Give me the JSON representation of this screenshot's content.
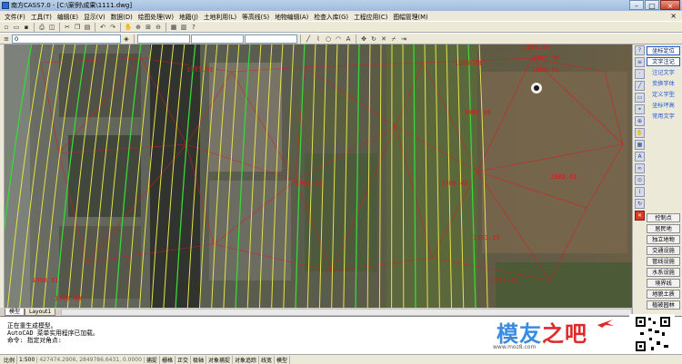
{
  "window": {
    "title": "南方CASS7.0 - [C:\\案例\\成果\\1111.dwg]",
    "buttons": [
      "–",
      "□",
      "×"
    ]
  },
  "menu": [
    "文件(F)",
    "工具(T)",
    "编辑(E)",
    "显示(V)",
    "数据(D)",
    "绘图处理(W)",
    "地籍(J)",
    "土地利用(L)",
    "等高线(S)",
    "地物编辑(A)",
    "检查入库(G)",
    "工程应用(C)",
    "图幅管理(M)"
  ],
  "menu_close": "×",
  "toolbar": {
    "layer_combo": "0"
  },
  "canvas": {
    "labels": [
      "1989.54",
      "1987.99",
      "1985.62",
      "1991.61",
      "1990.58",
      "1988.99",
      "1991.02",
      "1986.48",
      "1989.61",
      "1991.19",
      "1992.81",
      "1990.81",
      "1989.88"
    ]
  },
  "layout_tabs": [
    "模型",
    "Layout1"
  ],
  "right_panel": {
    "top_buttons": [
      "坐标定位",
      "文字注记",
      "注记文字",
      "变换字体",
      "定义字型",
      "坐标坪高",
      "常用文字"
    ],
    "bottom_buttons": [
      "控制点",
      "居民地",
      "独立地物",
      "交通设施",
      "管线设施",
      "水系设施",
      "境界线",
      "地貌土质",
      "植被园林"
    ]
  },
  "command": {
    "lines": [
      "正在重生成模型。",
      "AutoCAD 菜单实用程序已加载。",
      "命令: 指定对角点:"
    ]
  },
  "status": {
    "scale_label": "比例",
    "scale": "1:500",
    "coords": "427474.2906, 2849786.6431, 0.0000",
    "toggles": [
      "捕捉",
      "栅格",
      "正交",
      "极轴",
      "对象捕捉",
      "对象追踪",
      "线宽",
      "模型"
    ]
  },
  "watermark": {
    "text_a": "模友",
    "text_b": "之吧",
    "url": "www.moz8.com"
  },
  "colors": {
    "contour_yellow": "#e8e24a",
    "contour_green": "#3ad63a",
    "annotation_red": "#e01818",
    "title_bar": "#b9d1ea"
  }
}
